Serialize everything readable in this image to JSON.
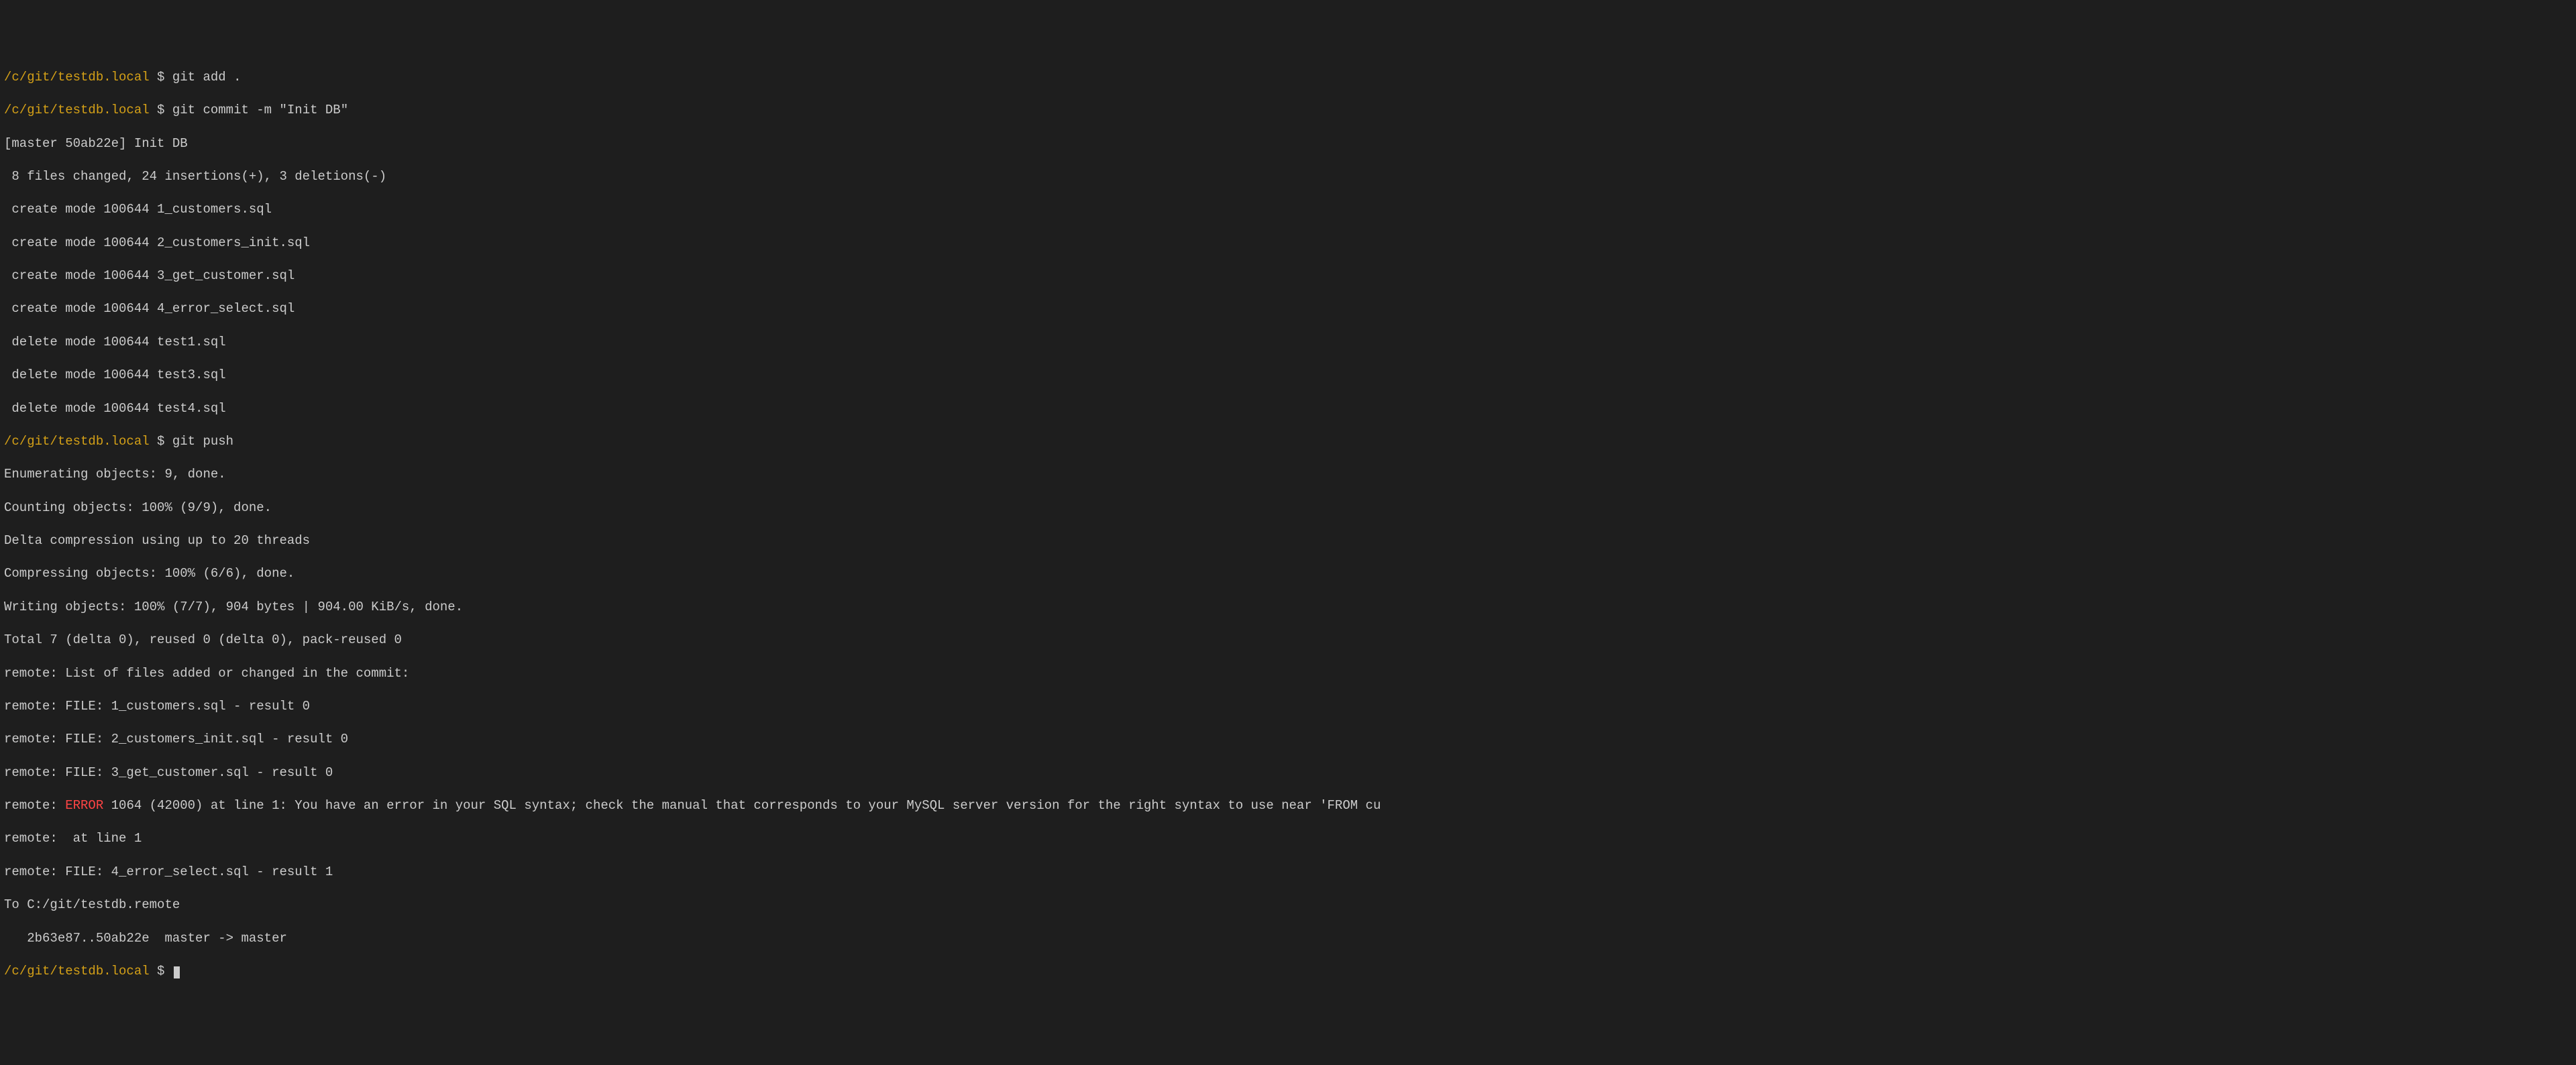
{
  "prompt_path": "/c/git/testdb.local",
  "dollar": " $ ",
  "cmd1": "git add .",
  "cmd2": "git commit -m \"Init DB\"",
  "commit_line1": "[master 50ab22e] Init DB",
  "commit_line2": " 8 files changed, 24 insertions(+), 3 deletions(-)",
  "commit_line3": " create mode 100644 1_customers.sql",
  "commit_line4": " create mode 100644 2_customers_init.sql",
  "commit_line5": " create mode 100644 3_get_customer.sql",
  "commit_line6": " create mode 100644 4_error_select.sql",
  "commit_line7": " delete mode 100644 test1.sql",
  "commit_line8": " delete mode 100644 test3.sql",
  "commit_line9": " delete mode 100644 test4.sql",
  "cmd3": "git push",
  "push_line1": "Enumerating objects: 9, done.",
  "push_line2": "Counting objects: 100% (9/9), done.",
  "push_line3": "Delta compression using up to 20 threads",
  "push_line4": "Compressing objects: 100% (6/6), done.",
  "push_line5": "Writing objects: 100% (7/7), 904 bytes | 904.00 KiB/s, done.",
  "push_line6": "Total 7 (delta 0), reused 0 (delta 0), pack-reused 0",
  "push_line7": "remote: List of files added or changed in the commit:",
  "push_line8": "remote: FILE: 1_customers.sql - result 0",
  "push_line9": "remote: FILE: 2_customers_init.sql - result 0",
  "push_line10": "remote: FILE: 3_get_customer.sql - result 0",
  "push_line11_prefix": "remote: ",
  "push_line11_error": "ERROR",
  "push_line11_rest": " 1064 (42000) at line 1: You have an error in your SQL syntax; check the manual that corresponds to your MySQL server version for the right syntax to use near 'FROM cu",
  "push_line12": "remote:  at line 1",
  "push_line13": "remote: FILE: 4_error_select.sql - result 1",
  "push_line14": "To C:/git/testdb.remote",
  "push_line15": "   2b63e87..50ab22e  master -> master"
}
